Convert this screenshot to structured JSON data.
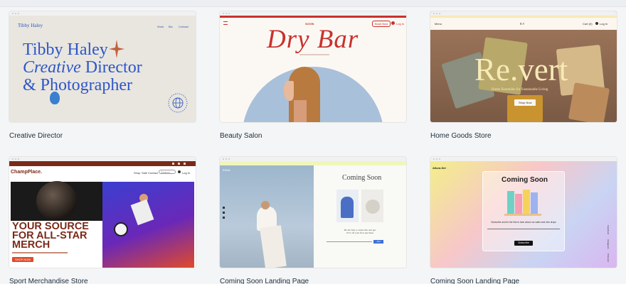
{
  "templates": [
    {
      "caption": "Creative Director",
      "site": {
        "logo": "Tibby Haley",
        "nav": [
          "Work",
          "Bio",
          "Contact"
        ],
        "headline_line1": "Tibby Haley",
        "headline_line2_em": "Creative",
        "headline_line2_rest": " Director",
        "headline_line3": "& Photographer"
      }
    },
    {
      "caption": "Beauty Salon",
      "site": {
        "brand": "SOVIN",
        "book_button": "Book Now",
        "login": "Log In",
        "headline": "Dry Bar"
      }
    },
    {
      "caption": "Home Goods Store",
      "site": {
        "menu": "Menu",
        "mark": "R.V",
        "cart": "Cart (0)",
        "login": "Log In",
        "headline": "Re.vert",
        "tagline": "Home Essentials for Sustainable Living",
        "button": "Shop Now"
      }
    },
    {
      "caption": "Sport Merchandise Store",
      "site": {
        "logo": "ChampPlace.",
        "nav": [
          "Shop",
          "Sale",
          "Contact"
        ],
        "search_placeholder": "Search...",
        "login": "Log In",
        "headline_line1": "YOUR SOURCE",
        "headline_line2": "FOR ALL-STAR",
        "headline_line3": "MERCH",
        "button": "SHOP NOW"
      }
    },
    {
      "caption": "Coming Soon Landing Page",
      "site": {
        "brand": "ENVA",
        "headline": "Coming Soon",
        "subscribe_line1": "Be the first to subscribe and get",
        "subscribe_line2": "10% off your first purchase",
        "button": "Join"
      }
    },
    {
      "caption": "Coming Soon Landing Page",
      "site": {
        "brand": "Allura.Set",
        "headline": "Coming Soon",
        "subscribe_text": "Subscribe and be the first to hear about our sales and new drops",
        "button": "Subscribe",
        "side_links": [
          "Facebook",
          "Instagram",
          "Pinterest"
        ]
      }
    }
  ],
  "colors": {
    "page_bg": "#f4f5f7",
    "caption_text": "#20303c",
    "creative_blue": "#2d56c8",
    "drybar_red": "#c8322e",
    "revert_cream": "#f6eab8",
    "champ_brown": "#7a2a18",
    "champ_orange": "#e04a2a"
  }
}
